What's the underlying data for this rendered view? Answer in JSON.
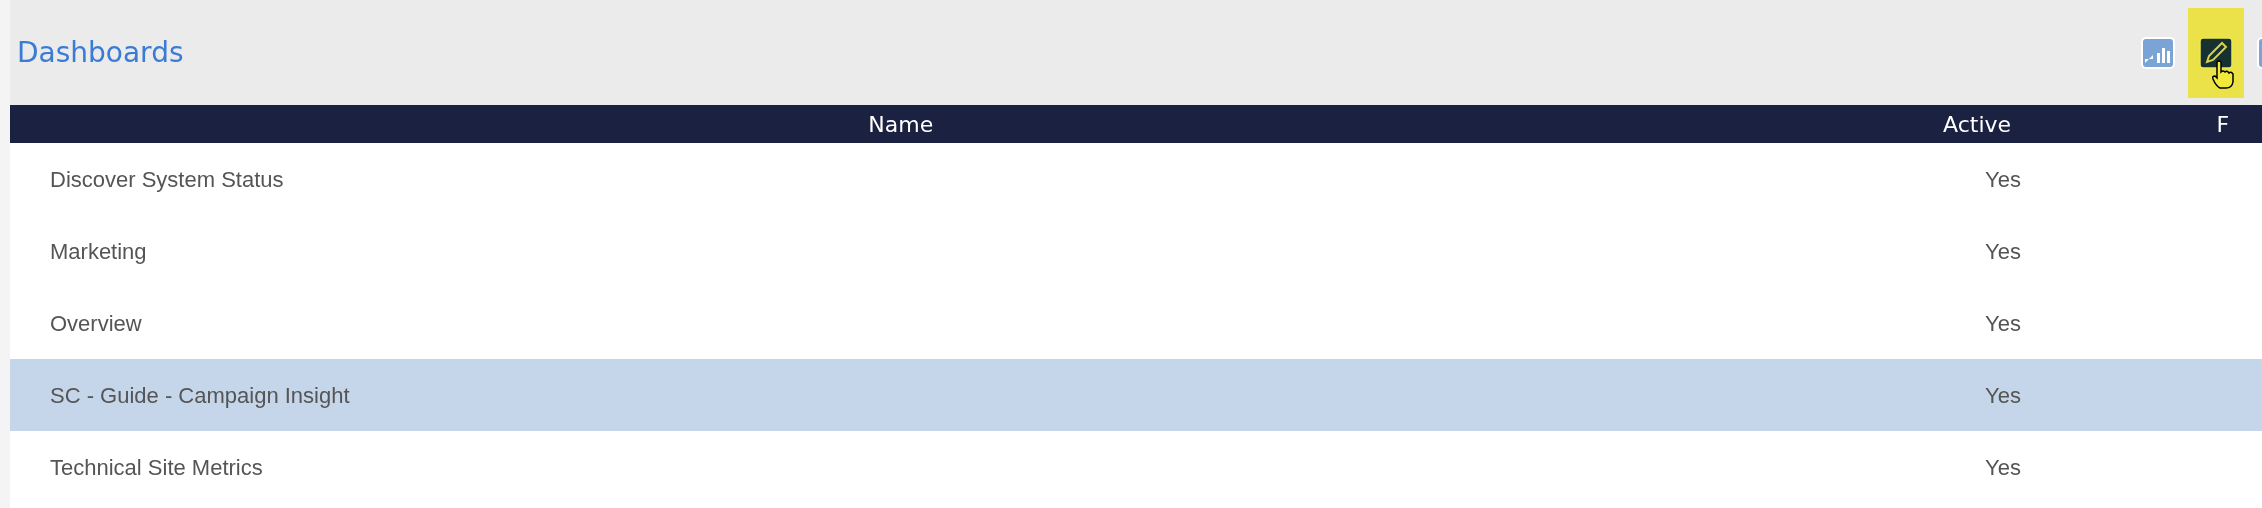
{
  "header": {
    "title": "Dashboards",
    "toolbar": [
      {
        "kind": "report",
        "selected": false
      },
      {
        "kind": "edit",
        "selected": true
      },
      {
        "kind": "other",
        "selected": false
      }
    ]
  },
  "table": {
    "columns": [
      "Name",
      "Active",
      "F"
    ],
    "rows": [
      {
        "name": "Discover System Status",
        "active": "Yes",
        "selected": false
      },
      {
        "name": "Marketing",
        "active": "Yes",
        "selected": false
      },
      {
        "name": "Overview",
        "active": "Yes",
        "selected": false
      },
      {
        "name": "SC - Guide - Campaign Insight",
        "active": "Yes",
        "selected": true
      },
      {
        "name": "Technical Site Metrics",
        "active": "Yes",
        "selected": false
      }
    ]
  }
}
